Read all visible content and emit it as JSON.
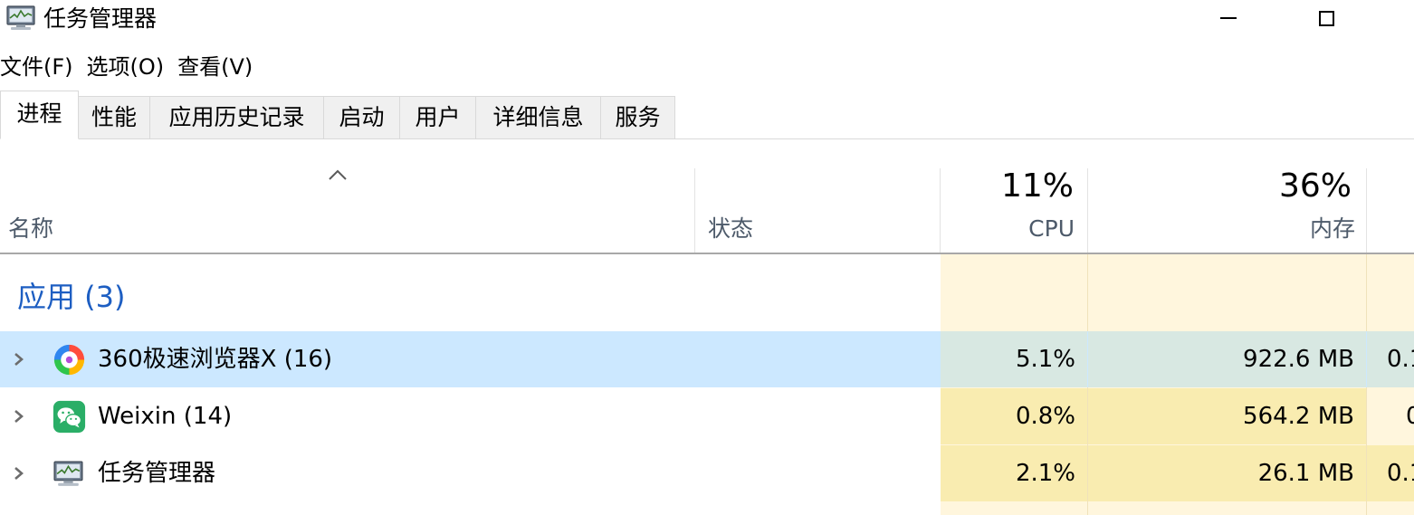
{
  "window": {
    "title": "任务管理器"
  },
  "menu": [
    "文件(F)",
    "选项(O)",
    "查看(V)"
  ],
  "tabs": [
    {
      "label": "进程",
      "active": true
    },
    {
      "label": "性能",
      "active": false
    },
    {
      "label": "应用历史记录",
      "active": false
    },
    {
      "label": "启动",
      "active": false
    },
    {
      "label": "用户",
      "active": false
    },
    {
      "label": "详细信息",
      "active": false
    },
    {
      "label": "服务",
      "active": false
    }
  ],
  "columns": {
    "name": "名称",
    "status": "状态",
    "cpu": {
      "percent": "11%",
      "label": "CPU"
    },
    "memory": {
      "percent": "36%",
      "label": "内存"
    }
  },
  "group": {
    "title": "应用 (3)"
  },
  "rows": [
    {
      "name": "360极速浏览器X (16)",
      "cpu": "5.1%",
      "memory": "922.6 MB",
      "next": "0.1",
      "icon": "360-browser-icon",
      "selected": true
    },
    {
      "name": "Weixin (14)",
      "cpu": "0.8%",
      "memory": "564.2 MB",
      "next": "0",
      "icon": "weixin-icon",
      "selected": false
    },
    {
      "name": "任务管理器",
      "cpu": "2.1%",
      "memory": "26.1 MB",
      "next": "0.1",
      "icon": "task-manager-icon",
      "selected": false
    }
  ],
  "colors": {
    "selection": "#cce8ff",
    "usage_light": "#fff6dd",
    "usage_medium": "#f9ecb0",
    "group_title": "#1d5ec2"
  }
}
